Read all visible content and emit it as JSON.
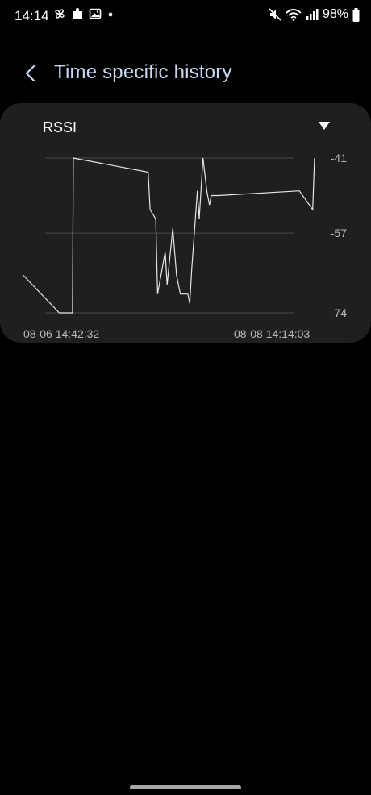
{
  "status_bar": {
    "time": "14:14",
    "battery": "98%",
    "icons_left": [
      "pinwheel-icon",
      "puzzle-icon",
      "image-icon",
      "dot-icon"
    ],
    "icons_right": [
      "mute-icon",
      "wifi-icon",
      "signal-icon",
      "battery-icon"
    ]
  },
  "header": {
    "back_icon": "chevron-left-icon",
    "title": "Time specific history"
  },
  "card": {
    "dropdown_label": "RSSI",
    "dropdown_icon": "triangle-down-icon"
  },
  "chart_data": {
    "type": "line",
    "title": "",
    "xlabel": "",
    "ylabel": "",
    "x_start_label": "08-06 14:42:32",
    "x_end_label": "08-08 14:14:03",
    "y_ticks": [
      "-41",
      "-57",
      "-74"
    ],
    "ylim": [
      -74,
      -41
    ],
    "grid": true,
    "line_color": "#e6e6e6",
    "grid_color": "#4a4a4a",
    "series": [
      {
        "x": [
          0,
          0.95,
          1.05,
          1.3,
          1.32,
          3.3,
          3.35,
          3.5,
          3.55,
          3.75,
          3.8,
          3.95,
          4.05,
          4.15,
          4.35,
          4.4,
          4.45,
          4.6,
          4.65,
          4.75,
          4.85,
          4.92,
          4.97,
          5.15,
          7.3,
          7.65,
          7.7
        ],
        "y": [
          -66,
          -74,
          -74,
          -74,
          -41,
          -44,
          -52,
          -54,
          -70,
          -61,
          -68,
          -56,
          -66,
          -70,
          -70,
          -72,
          -65,
          -48,
          -54,
          -41,
          -48,
          -51,
          -49,
          -49,
          -48,
          -52,
          -41
        ]
      }
    ]
  }
}
